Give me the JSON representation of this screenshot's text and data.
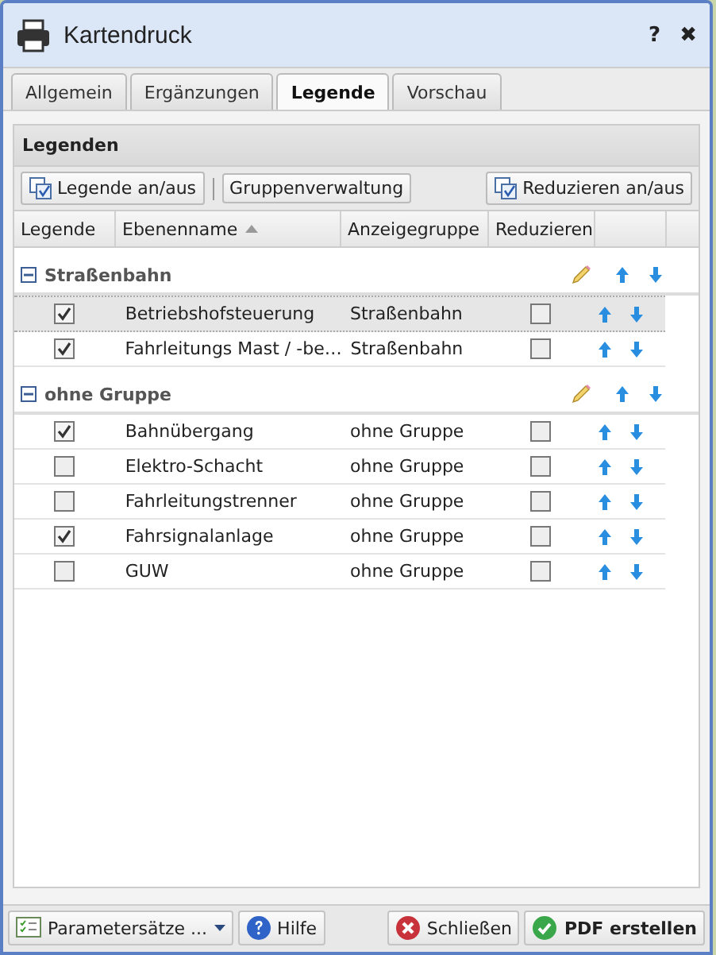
{
  "window": {
    "title": "Kartendruck",
    "help": "?",
    "close": "✖"
  },
  "tabs": [
    {
      "label": "Allgemein",
      "selected": false
    },
    {
      "label": "Ergänzungen",
      "selected": false
    },
    {
      "label": "Legende",
      "selected": true
    },
    {
      "label": "Vorschau",
      "selected": false
    }
  ],
  "panel": {
    "title": "Legenden",
    "toolbar": [
      {
        "label": "Legende an/aus",
        "kind": "toggle"
      },
      {
        "label": "Gruppenverwaltung",
        "kind": "plain"
      },
      {
        "label": "Reduzieren an/aus",
        "kind": "toggle"
      }
    ],
    "columns": [
      {
        "label": "Legende",
        "sorted": false
      },
      {
        "label": "Ebenenname",
        "sorted": true
      },
      {
        "label": "Anzeigegruppe",
        "sorted": false
      },
      {
        "label": "Reduzieren",
        "sorted": false
      }
    ],
    "groups": [
      {
        "name": "Straßenbahn",
        "expanded": true,
        "rows": [
          {
            "legend": true,
            "name": "Betriebshofsteuerung",
            "group": "Straßenbahn",
            "reduce": false,
            "selected": true
          },
          {
            "legend": true,
            "name": "Fahrleitungs Mast / -be…",
            "group": "Straßenbahn",
            "reduce": false,
            "selected": false
          }
        ]
      },
      {
        "name": "ohne Gruppe",
        "expanded": true,
        "rows": [
          {
            "legend": true,
            "name": "Bahnübergang",
            "group": "ohne Gruppe",
            "reduce": false,
            "selected": false
          },
          {
            "legend": false,
            "name": "Elektro-Schacht",
            "group": "ohne Gruppe",
            "reduce": false,
            "selected": false
          },
          {
            "legend": false,
            "name": "Fahrleitungstrenner",
            "group": "ohne Gruppe",
            "reduce": false,
            "selected": false
          },
          {
            "legend": true,
            "name": "Fahrsignalanlage",
            "group": "ohne Gruppe",
            "reduce": false,
            "selected": false
          },
          {
            "legend": false,
            "name": "GUW",
            "group": "ohne Gruppe",
            "reduce": false,
            "selected": false
          }
        ]
      }
    ]
  },
  "footer": [
    {
      "label": "Parametersätze ...",
      "kind": "menu"
    },
    {
      "label": "Hilfe",
      "kind": "help"
    },
    {
      "label": "Schließen",
      "kind": "close"
    },
    {
      "label": "PDF erstellen",
      "kind": "create"
    }
  ]
}
